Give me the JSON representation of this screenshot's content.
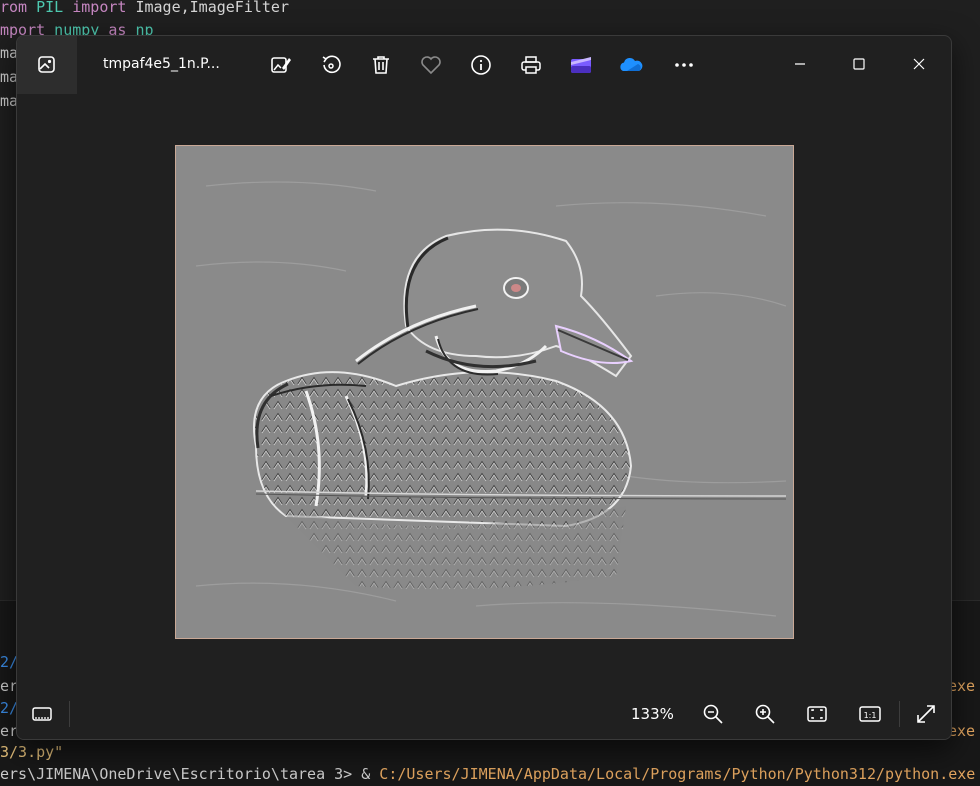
{
  "editor": {
    "lines": [
      {
        "kw1": "rom",
        "mid": " PIL ",
        "kw2": "import",
        "rest": " Image,ImageFilter"
      },
      {
        "kw1": "mport",
        "mid": " numpy ",
        "kw2": "as",
        "rest": " np"
      }
    ],
    "partial_lines": [
      "ma",
      "ma",
      "ma"
    ]
  },
  "terminal": {
    "lines": [
      {
        "prefix": "2/",
        "end": ""
      },
      {
        "prefix": "er",
        "end": "exe"
      },
      {
        "prefix": "2/",
        "end": ""
      },
      {
        "prefix": "er",
        "end": "exe"
      },
      {
        "prefix": "3/3.py\"",
        "end": ""
      }
    ],
    "prompt": "ers\\JIMENA\\OneDrive\\Escritorio\\tarea 3> & ",
    "command": "C:/Users/JIMENA/AppData/Local/Programs/Python/Python312/python.exe"
  },
  "window": {
    "filename": "tmpaf4e5_1n.P...",
    "toolbar": [
      "edit-image-icon",
      "rotate-icon",
      "delete-icon",
      "favorite-heart-icon",
      "info-icon",
      "print-icon",
      "clipchamp-icon",
      "onedrive-icon",
      "more-icon"
    ],
    "caption": [
      "minimize-icon",
      "maximize-icon",
      "close-icon"
    ],
    "zoom": "133%",
    "colors": {
      "accent_purple": "#7a5cff",
      "onedrive_blue": "#1e90ff"
    }
  }
}
